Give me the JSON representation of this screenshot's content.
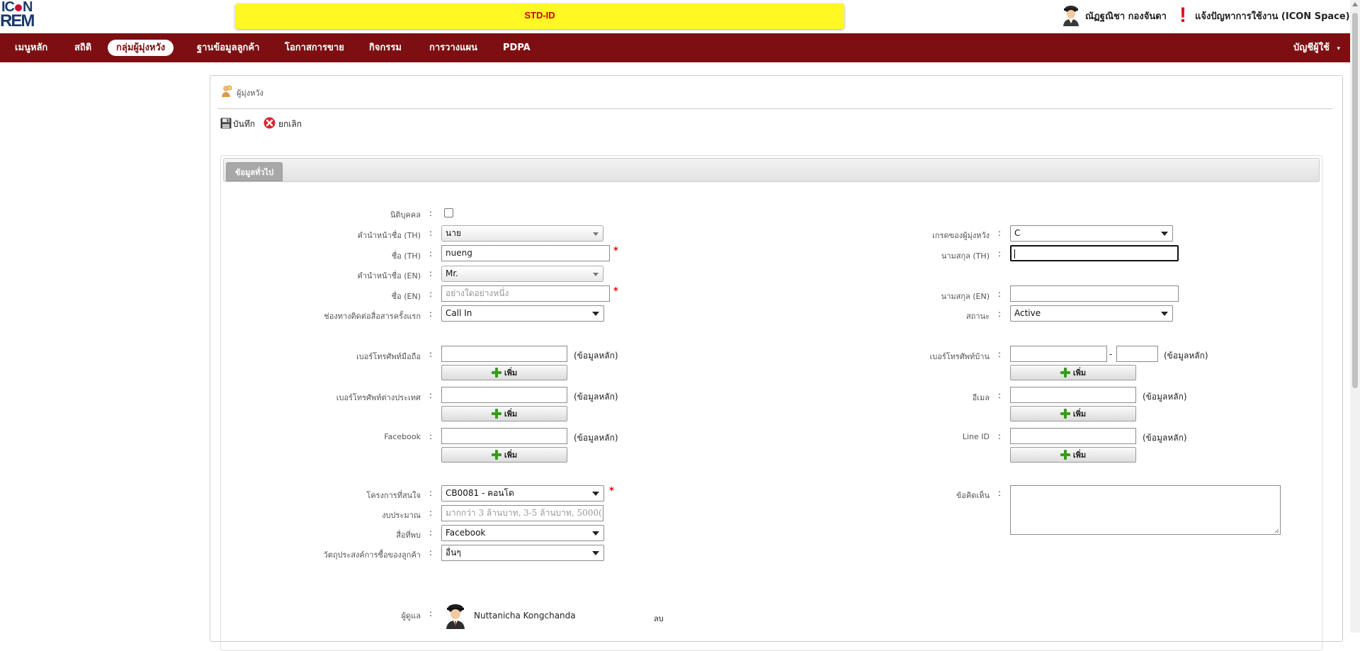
{
  "topbar": {
    "logo_line1": "IC",
    "logo_line1b": "N",
    "logo_line2": "REM",
    "banner": "STD-ID",
    "user_name": "ณัฏฐณิชา กองจันดา",
    "report": "แจ้งปัญหาการใช้งาน (ICON Space)"
  },
  "nav": {
    "items": [
      "เมนูหลัก",
      "สถิติ",
      "กลุ่มผู้มุ่งหวัง",
      "ฐานข้อมูลลูกค้า",
      "โอกาสการขาย",
      "กิจกรรม",
      "การวางแผน",
      "PDPA"
    ],
    "account": "บัญชีผู้ใช้"
  },
  "panel": {
    "title": "ผู้มุ่งหวัง",
    "save_label": "บันทึก",
    "cancel_label": "ยกเลิก",
    "tab_general": "ข้อมูลทั่วไป"
  },
  "form": {
    "colon": ":",
    "required_mark": "*",
    "juristic_label": "นิติบุคคล",
    "prefix_th_label": "คำนำหน้าชื่อ (TH)",
    "prefix_th_value": "นาย",
    "name_th_label": "ชื่อ (TH)",
    "name_th_value": "nueng",
    "prefix_en_label": "คำนำหน้าชื่อ (EN)",
    "prefix_en_value": "Mr.",
    "name_en_label": "ชื่อ (EN)",
    "name_en_placeholder": "อย่างใดอย่างหนึ่ง",
    "channel_label": "ช่องทางติดต่อสื่อสารครั้งแรก",
    "channel_value": "Call In",
    "grade_label": "เกรดของผู้มุ่งหวัง",
    "grade_value": "C",
    "surname_th_label": "นามสกุล (TH)",
    "surname_th_value": "",
    "surname_en_label": "นามสกุล (EN)",
    "surname_en_value": "",
    "status_label": "สถานะ",
    "status_value": "Active",
    "mobile_label": "เบอร์โทรศัพท์มือถือ",
    "intl_phone_label": "เบอร์โทรศัพท์ต่างประเทศ",
    "facebook_label": "Facebook",
    "home_phone_label": "เบอร์โทรศัพท์บ้าน",
    "email_label": "อีเมล",
    "line_label": "Line ID",
    "primary_hint": "(ข้อมูลหลัก)",
    "dash": "-",
    "add_label": "เพิ่ม",
    "project_label": "โครงการที่สนใจ",
    "project_value": "CB0081 - คอนโด",
    "budget_label": "งบประมาณ",
    "budget_placeholder": "มากกว่า 3 ล้านบาท, 3-5 ล้านบาท, 5000(",
    "media_label": "สื่อที่พบ",
    "media_value": "Facebook",
    "purpose_label": "วัตถุประสงค์การซื้อของลูกค้า",
    "purpose_value": "อื่นๆ",
    "comment_label": "ข้อคิดเห็น",
    "owner_label": "ผู้ดูแล",
    "owner_name": "Nuttanicha Kongchanda",
    "delete_label": "ลบ"
  },
  "colors": {
    "nav_bg": "#7d0f12",
    "banner_bg": "#fff823",
    "banner_text": "#cc0000",
    "required": "#ee0000"
  }
}
